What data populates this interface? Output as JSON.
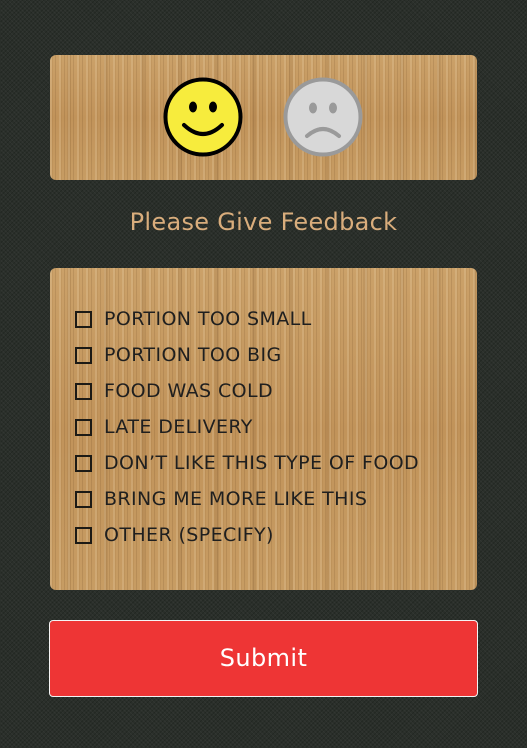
{
  "faces": [
    {
      "name": "happy",
      "selected": true,
      "color": "#f7ec3d"
    },
    {
      "name": "sad",
      "selected": false,
      "color": "#d6d6d6"
    }
  ],
  "feedback_title": "Please Give Feedback",
  "options": [
    {
      "label": "PORTION TOO SMALL",
      "checked": false
    },
    {
      "label": "PORTION TOO BIG",
      "checked": false
    },
    {
      "label": "FOOD WAS COLD",
      "checked": false
    },
    {
      "label": "LATE DELIVERY",
      "checked": false
    },
    {
      "label": "DON’T LIKE THIS TYPE OF FOOD",
      "checked": false
    },
    {
      "label": "BRING ME MORE LIKE THIS",
      "checked": false
    },
    {
      "label": "OTHER (SPECIFY)",
      "checked": false
    }
  ],
  "submit_label": "Submit",
  "colors": {
    "background": "#2a2f2a",
    "wood": "#c4985f",
    "title": "#d9ad7c",
    "submit": "#ee3535"
  }
}
